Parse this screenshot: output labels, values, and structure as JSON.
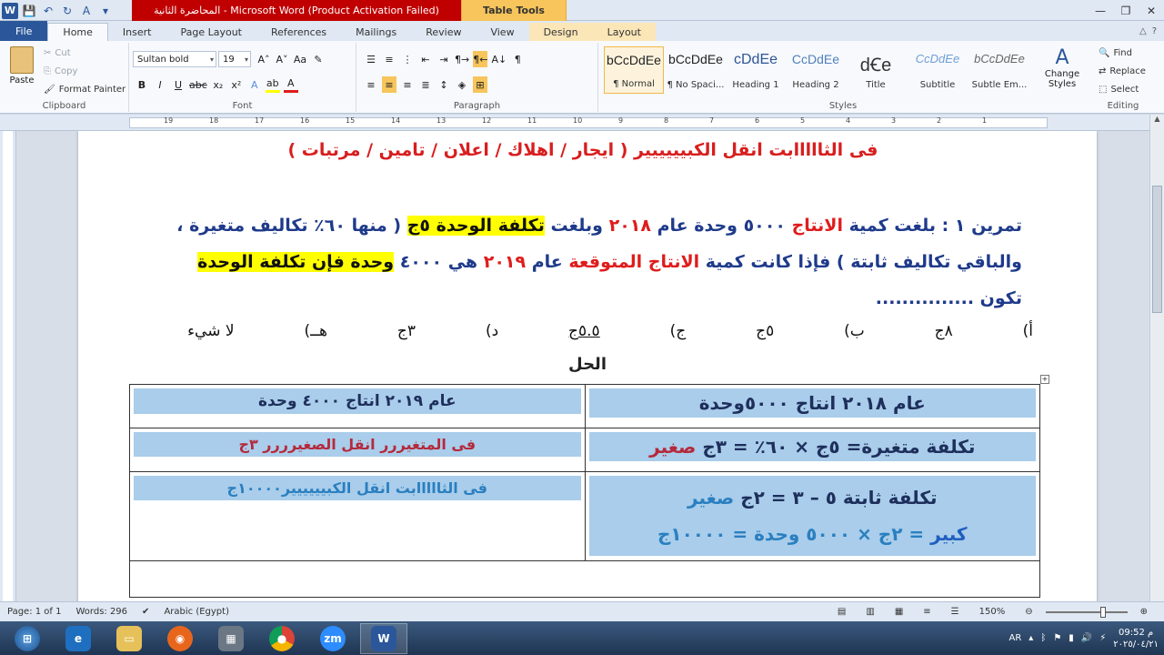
{
  "window": {
    "title": "المحاضرة الثانية  -  Microsoft Word (Product Activation Failed)",
    "context_tools": "Table Tools"
  },
  "tabs": [
    "File",
    "Home",
    "Insert",
    "Page Layout",
    "References",
    "Mailings",
    "Review",
    "View",
    "Design",
    "Layout"
  ],
  "ribbon": {
    "clipboard": {
      "paste": "Paste",
      "cut": "Cut",
      "copy": "Copy",
      "format_painter": "Format Painter",
      "label": "Clipboard"
    },
    "font": {
      "name": "Sultan bold",
      "size": "19",
      "label": "Font"
    },
    "paragraph": {
      "label": "Paragraph"
    },
    "styles": {
      "label": "Styles",
      "items": [
        {
          "sample": "bCcDdEe",
          "name": "¶ Normal"
        },
        {
          "sample": "bCcDdEe",
          "name": "¶ No Spaci..."
        },
        {
          "sample": "cDdEe",
          "name": "Heading 1"
        },
        {
          "sample": "CcDdEe",
          "name": "Heading 2"
        },
        {
          "sample": "dꞒe",
          "name": "Title"
        },
        {
          "sample": "CcDdEe",
          "name": "Subtitle"
        },
        {
          "sample": "bCcDdEe",
          "name": "Subtle Em..."
        }
      ],
      "change_styles": "Change Styles"
    },
    "editing": {
      "find": "Find",
      "replace": "Replace",
      "select": "Select",
      "label": "Editing"
    }
  },
  "ruler_numbers": [
    "19",
    "18",
    "17",
    "16",
    "15",
    "14",
    "13",
    "12",
    "11",
    "10",
    "9",
    "8",
    "7",
    "6",
    "5",
    "4",
    "3",
    "2",
    "1"
  ],
  "document": {
    "heading": "فى الثااااابت انقل الكبيييييير ( ايجار / اهلاك / اعلان / تامين / مرتبات )",
    "exercise": {
      "p1": "تمرين ١ : بلغت كمية ",
      "p2": "الانتاج",
      "p3": " ٥٠٠٠ وحدة عام ",
      "p4": "٢٠١٨",
      "p5": " وبلغت ",
      "p6": "تكلفة الوحدة ٥ج",
      "p7": " ( منها ٦٠٪ تكاليف متغيرة ، والباقي تكاليف ثابتة ) فإذا كانت كمية ",
      "p8": "الانتاج المتوقعة",
      "p9": " عام ",
      "p10": "٢٠١٩",
      "p11": " هي ٤٠٠٠ ",
      "p12": "وحدة فإن تكلفة الوحدة",
      "p13": " تكون ..............."
    },
    "options": [
      "أ)",
      "٨ج",
      "ب)",
      "٥ج",
      "ج)",
      "٥.٥ج",
      "د)",
      "٣ج",
      "هــ)",
      "لا شيء"
    ],
    "solution_label": "الحل",
    "table": {
      "r1_right": "عام ٢٠١٨ انتاج ٥٠٠٠وحدة",
      "r1_left": "عام ٢٠١٩ انتاج ٤٠٠٠ وحدة",
      "r2_right_a": "تكلفة متغيرة= ٥ج × ٦٠٪ = ٣ج ",
      "r2_right_b": "صغير",
      "r2_left": "فى المتغيررر انقل الصغيرررر ٣ج",
      "r3_right_a": "تكلفة ثابتة ٥ – ٣ = ٢ج ",
      "r3_right_b": "صغير",
      "r3_right_c": "كبير",
      "r3_right_d": " = ٢ج × ٥٠٠٠ وحدة = ١٠٠٠٠ج",
      "r3_left": "فى الثااااابت انقل الكبيييييير١٠٠٠٠ج"
    }
  },
  "status": {
    "page": "Page: 1 of 1",
    "words": "Words: 296",
    "language": "Arabic (Egypt)",
    "zoom": "150%"
  },
  "taskbar": {
    "lang": "AR",
    "time": "09:52 م",
    "date": "٢٠٢٥/٠٤/٢١"
  }
}
